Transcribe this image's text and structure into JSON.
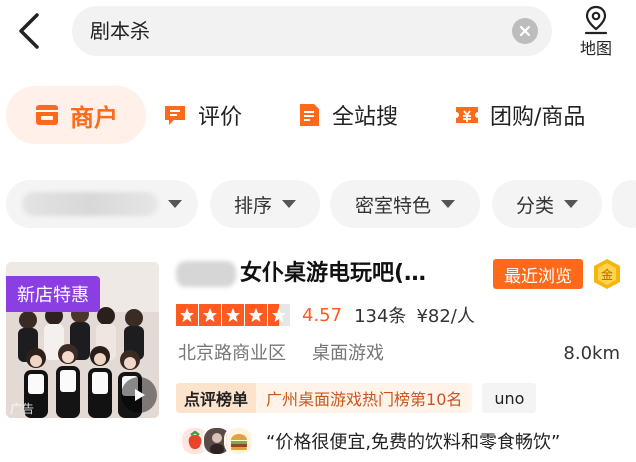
{
  "search": {
    "query": "剧本杀"
  },
  "header": {
    "map_label": "地图"
  },
  "tabs": [
    {
      "label": "商户",
      "active": true
    },
    {
      "label": "评价",
      "active": false
    },
    {
      "label": "全站搜",
      "active": false
    },
    {
      "label": "团购/商品",
      "active": false
    }
  ],
  "filters": [
    {
      "label": ""
    },
    {
      "label": "排序"
    },
    {
      "label": "密室特色"
    },
    {
      "label": "分类"
    }
  ],
  "listing": {
    "badge": "新店特惠",
    "ad_text": "广告",
    "title": "女仆桌游电玩吧(…",
    "recent_badge": "最近浏览",
    "gold_badge": "金",
    "rating": 4.5,
    "score": "4.57",
    "reviews": "134条",
    "price": "¥82/人",
    "area": "北京路商业区",
    "category": "桌面游戏",
    "distance": "8.0km",
    "rank_label": "点评榜单",
    "rank_text": "广州桌面游戏热门榜第10名",
    "tag": "uno",
    "quote": "“价格很便宜,免费的饮料和零食畅饮”"
  },
  "colors": {
    "accent": "#ff6a1a",
    "star": "#ff5a1f",
    "badge_purple": "#8b3ee2"
  }
}
